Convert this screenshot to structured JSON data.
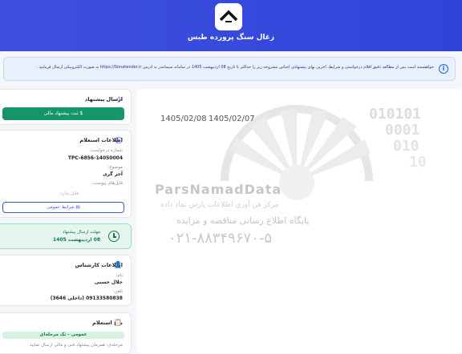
{
  "header": {
    "title": "زغال سنگ پرورده طبس",
    "logo_icon": "house-roof-icon"
  },
  "notice": {
    "text": "خواهشمند است پس از مطالعه دقیق اقلام درخواستی و شرایط، آخرین بهای پیشنهادی اجناس مشروحه زیر را حداکثر تا تاریخ 08 اردیبهشت 1405 در سامانه سیماتندر به آدرس https://Simatender.ir به صورت الکترونیکی ارسال فرمایید .",
    "icon": "info-icon"
  },
  "main": {
    "date_left": "1405/02/08",
    "date_right": "1405/02/07",
    "watermark": {
      "brand": "ParsNamadData",
      "line1": "مرکز فن آوری اطلاعات پارس نماد داده",
      "line2": "پایگاه اطلاع رسانی مناقصه و مزایده",
      "phone": "۰۲۱-۸۸۳۴۹۶۷۰-۵"
    }
  },
  "send_offer": {
    "title": "ارسال پیشنهاد",
    "icon": "warning-icon",
    "button_label": "ثبت پیشنهاد مالی",
    "button_icon": "dollar-icon"
  },
  "inquiry": {
    "title": "اطلاعات استعلام",
    "icon": "info-icon",
    "request_number_label": "شماره درخواست:",
    "request_number": "TPC-6856-14050004",
    "subject_label": "موضوع:",
    "subject": "آجر گری",
    "attachments_label": "فایل‌های پیوست:",
    "attachments_empty": "فایل ندارد",
    "terms_button": "شرایط عمومی",
    "terms_icon": "file-icon"
  },
  "deadline": {
    "label": "مهلت ارسال پیشنهاد",
    "value": "08 اردیبهشت 1405",
    "icon": "clock-icon"
  },
  "expert": {
    "title": "اطلاعات کارشناس",
    "icon": "user-icon",
    "name_label": "نام:",
    "name": "جلال حسنی",
    "phone_label": "تلفن:",
    "phone": "09133580838 (داخلی 3646)"
  },
  "inquiry_type": {
    "title": "نوع استعلام",
    "icon": "clipboard-icon",
    "badge": "عمومی - تک مرحله‌ای",
    "description": "مرحله‌ی: همزمان پیشنهاد فنی و مالی ارسال نمایید"
  }
}
